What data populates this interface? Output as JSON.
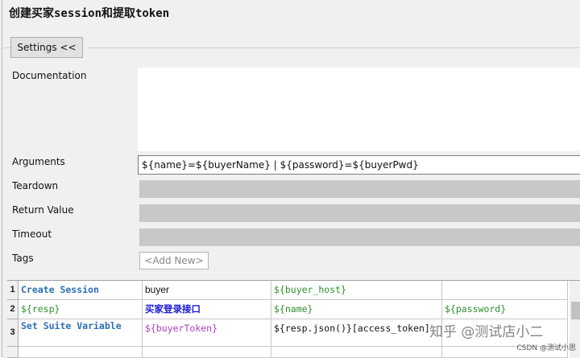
{
  "title": "创建买家session和提取token",
  "settings": {
    "button_label": "Settings <<"
  },
  "fields": {
    "documentation": {
      "label": "Documentation",
      "value": ""
    },
    "arguments": {
      "label": "Arguments",
      "value": "${name}=${buyerName} | ${password}=${buyerPwd}"
    },
    "teardown": {
      "label": "Teardown"
    },
    "return_value": {
      "label": "Return Value"
    },
    "timeout": {
      "label": "Timeout"
    },
    "tags": {
      "label": "Tags",
      "add_label": "<Add New>"
    }
  },
  "grid": {
    "rows": [
      {
        "num": "1",
        "cells": [
          "Create Session",
          "buyer",
          "${buyer_host}",
          ""
        ]
      },
      {
        "num": "2",
        "cells": [
          "${resp}",
          "买家登录接口",
          "${name}",
          "${password}"
        ]
      },
      {
        "num": "3",
        "cells": [
          "Set Suite Variable",
          "${buyerToken}",
          "${resp.json()}[access_token]",
          ""
        ]
      }
    ]
  },
  "watermark": {
    "main": "知乎 @测试店小二",
    "small": "CSDN @测试小思"
  }
}
